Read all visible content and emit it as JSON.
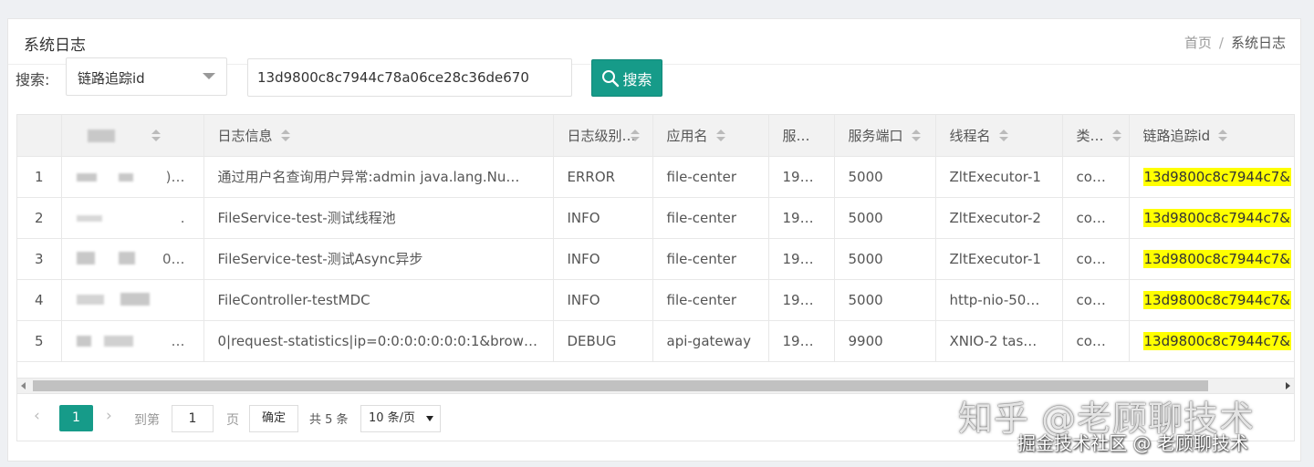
{
  "header": {
    "title": "系统日志",
    "breadcrumb": {
      "home": "首页",
      "separator": "/",
      "current": "系统日志"
    }
  },
  "search": {
    "label": "搜索:",
    "field_selected": "链路追踪id",
    "query_value": "13d9800c8c7944c78a06ce28c36de670",
    "button_label": "搜索"
  },
  "table": {
    "columns": [
      "",
      "",
      "日志信息",
      "日志级别",
      "应用名",
      "服…",
      "服务端口",
      "线程名",
      "类…",
      "链路追踪id"
    ],
    "rows": [
      {
        "index": "1",
        "time_tail": ")…",
        "message": "通过用户名查询用户异常:admin java.lang.Nu…",
        "level": "ERROR",
        "app": "file-center",
        "server_ip": "19…",
        "port": "5000",
        "thread": "ZltExecutor-1",
        "class": "co…",
        "trace_id": "13d9800c8c7944c7&"
      },
      {
        "index": "2",
        "time_tail": ".",
        "message": "FileService-test-测试线程池",
        "level": "INFO",
        "app": "file-center",
        "server_ip": "19…",
        "port": "5000",
        "thread": "ZltExecutor-2",
        "class": "co…",
        "trace_id": "13d9800c8c7944c7&"
      },
      {
        "index": "3",
        "time_tail": "0…",
        "message": "FileService-test-测试Async异步",
        "level": "INFO",
        "app": "file-center",
        "server_ip": "19…",
        "port": "5000",
        "thread": "ZltExecutor-1",
        "class": "co…",
        "trace_id": "13d9800c8c7944c7&"
      },
      {
        "index": "4",
        "time_tail": "",
        "message": "FileController-testMDC",
        "level": "INFO",
        "app": "file-center",
        "server_ip": "19…",
        "port": "5000",
        "thread": "http-nio-50…",
        "class": "co…",
        "trace_id": "13d9800c8c7944c7&"
      },
      {
        "index": "5",
        "time_tail": "…",
        "message": "0|request-statistics|ip=0:0:0:0:0:0:0:1&brows…",
        "level": "DEBUG",
        "app": "api-gateway",
        "server_ip": "19…",
        "port": "9900",
        "thread": "XNIO-2 tas…",
        "class": "co…",
        "trace_id": "13d9800c8c7944c7&"
      }
    ]
  },
  "pagination": {
    "current_page": "1",
    "goto_label": "到第",
    "goto_value": "1",
    "page_unit": "页",
    "confirm_label": "确定",
    "total_label": "共 5 条",
    "page_size_label": "10 条/页"
  },
  "watermarks": {
    "zhihu": "知乎 @老顾聊技术",
    "juejin": "掘金技术社区 @ 老顾聊技术"
  },
  "colors": {
    "accent": "#169b89",
    "highlight": "#ffff00"
  }
}
